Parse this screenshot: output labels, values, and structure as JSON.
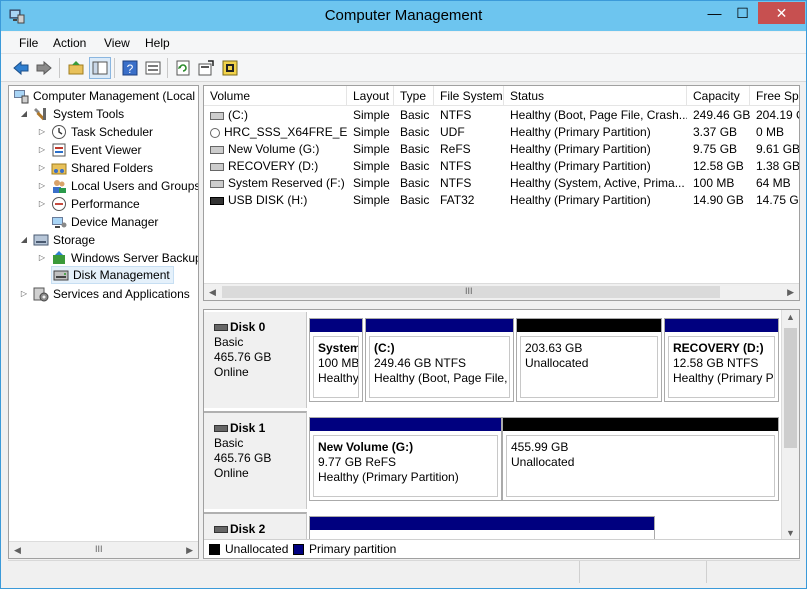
{
  "window": {
    "title": "Computer Management",
    "controls": {
      "minimize": "—",
      "maximize": "☐",
      "close": "✕"
    }
  },
  "menu": [
    "File",
    "Action",
    "View",
    "Help"
  ],
  "toolbar": {
    "icons": [
      "back-arrow-icon",
      "forward-arrow-icon",
      "up-folder-icon",
      "show-hide-tree-icon",
      "help-icon",
      "properties-icon",
      "refresh-icon",
      "export-icon",
      "settings-icon"
    ]
  },
  "tree": {
    "root": "Computer Management (Local",
    "system_tools": "System Tools",
    "task_scheduler": "Task Scheduler",
    "event_viewer": "Event Viewer",
    "shared_folders": "Shared Folders",
    "local_users": "Local Users and Groups",
    "performance": "Performance",
    "device_manager": "Device Manager",
    "storage": "Storage",
    "wsb": "Windows Server Backup",
    "disk_management": "Disk Management",
    "services": "Services and Applications",
    "scroll_marker": "III"
  },
  "volume_list": {
    "columns": [
      "Volume",
      "Layout",
      "Type",
      "File System",
      "Status",
      "Capacity",
      "Free Spa"
    ],
    "rows": [
      [
        "(C:)",
        "Simple",
        "Basic",
        "NTFS",
        "Healthy (Boot, Page File, Crash...",
        "249.46 GB",
        "204.19 G"
      ],
      [
        "HRC_SSS_X64FRE_EN...",
        "Simple",
        "Basic",
        "UDF",
        "Healthy (Primary Partition)",
        "3.37 GB",
        "0 MB"
      ],
      [
        "New Volume (G:)",
        "Simple",
        "Basic",
        "ReFS",
        "Healthy (Primary Partition)",
        "9.75 GB",
        "9.61 GB"
      ],
      [
        "RECOVERY (D:)",
        "Simple",
        "Basic",
        "NTFS",
        "Healthy (Primary Partition)",
        "12.58 GB",
        "1.38 GB"
      ],
      [
        "System Reserved (F:)",
        "Simple",
        "Basic",
        "NTFS",
        "Healthy (System, Active, Prima...",
        "100 MB",
        "64 MB"
      ],
      [
        "USB DISK (H:)",
        "Simple",
        "Basic",
        "FAT32",
        "Healthy (Primary Partition)",
        "14.90 GB",
        "14.75 GB"
      ]
    ],
    "scroll_marker": "III"
  },
  "disks": [
    {
      "name": "Disk 0",
      "type": "Basic",
      "size": "465.76 GB",
      "state": "Online",
      "partitions": [
        {
          "title": "System",
          "line2": "100 MB",
          "line3": "Healthy",
          "bar": "#00007f"
        },
        {
          "title": "(C:)",
          "line2": "249.46 GB NTFS",
          "line3": "Healthy (Boot, Page File, C",
          "bar": "#00007f"
        },
        {
          "title": "",
          "line2": "203.63 GB",
          "line3": "Unallocated",
          "bar": "#000000"
        },
        {
          "title": "RECOVERY  (D:)",
          "line2": "12.58 GB NTFS",
          "line3": "Healthy (Primary P",
          "bar": "#00007f"
        }
      ]
    },
    {
      "name": "Disk 1",
      "type": "Basic",
      "size": "465.76 GB",
      "state": "Online",
      "partitions": [
        {
          "title": "New Volume  (G:)",
          "line2": "9.77 GB ReFS",
          "line3": "Healthy (Primary Partition)",
          "bar": "#00007f"
        },
        {
          "title": "",
          "line2": "455.99 GB",
          "line3": "Unallocated",
          "bar": "#000000"
        }
      ]
    },
    {
      "name": "Disk 2",
      "partitions": [
        {
          "bar": "#00007f"
        }
      ]
    }
  ],
  "legend": {
    "unallocated": "Unallocated",
    "primary": "Primary partition",
    "unallocated_color": "#000000",
    "primary_color": "#00007f"
  }
}
